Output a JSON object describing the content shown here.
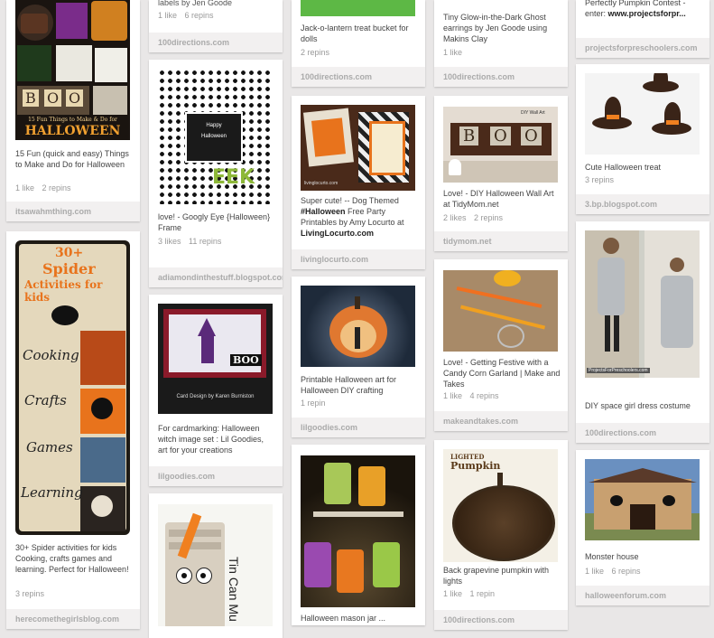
{
  "col1": {
    "pin1": {
      "desc": "15 Fun (quick and easy) Things to Make and Do for Halloween",
      "likes": "1 like",
      "repins": "2 repins",
      "source": "itsawahmthing.com",
      "img_caption": "15 Fun Things to Make & Do for",
      "img_title": "HALLOWEEN",
      "img_letters": [
        "B",
        "O",
        "O"
      ]
    },
    "pin2": {
      "desc": "30+ Spider activities for kids Cooking, crafts games and learning. Perfect for Halloween!",
      "likes": "",
      "repins": "3 repins",
      "source": "herecomethegirlsblog.com",
      "img_top": "30+",
      "img_title1": "Spider",
      "img_title2": "Activities for kids",
      "img_words": [
        "Cooking",
        "Crafts",
        "Games",
        "Learning"
      ]
    }
  },
  "col2": {
    "pin0": {
      "desc": "labels by Jen Goode",
      "likes": "1 like",
      "repins": "6 repins",
      "source": "100directions.com"
    },
    "pin1": {
      "desc": "love! - Googly Eye {Halloween} Frame",
      "likes": "3 likes",
      "repins": "11 repins",
      "source": "adiamondinthestuff.blogspot.com",
      "img_text1": "Happy",
      "img_text2": "Halloween",
      "img_text3": "EEK"
    },
    "pin2": {
      "desc": "For cardmarking: Halloween witch image set : Lil Goodies, art for your creations",
      "likes": "",
      "repins": "",
      "source": "lilgoodies.com",
      "img_boo": "BOO",
      "img_credit": "Card Design by Karen Burniston"
    },
    "pin3": {
      "desc": "",
      "likes": "",
      "repins": "",
      "source": "",
      "img_text": "Tin Can Mu"
    }
  },
  "col3": {
    "pin0": {
      "desc": "Jack-o-lantern treat bucket for dolls",
      "likes": "",
      "repins": "2 repins",
      "source": "100directions.com"
    },
    "pin1": {
      "desc_pre": "Super cute! -- Dog Themed ",
      "desc_bold": "#Halloween",
      "desc_post": " Free Party Printables by Amy Locurto at ",
      "desc_bold2": "LivingLocurto.com",
      "likes": "",
      "repins": "",
      "source": "livinglocurto.com",
      "img_credit": "livinglocurto.com"
    },
    "pin2": {
      "desc": "Printable Halloween art for Halloween DIY crafting",
      "likes": "",
      "repins": "1 repin",
      "source": "lilgoodies.com"
    },
    "pin3": {
      "desc": "Halloween mason jar ...",
      "likes": "",
      "repins": "",
      "source": ""
    }
  },
  "col4": {
    "pin0": {
      "desc": "Tiny Glow-in-the-Dark Ghost earrings by Jen Goode using Makins Clay",
      "likes": "1 like",
      "repins": "",
      "source": "100directions.com"
    },
    "pin1": {
      "desc": "Love! - DIY Halloween Wall Art at TidyMom.net",
      "likes": "2 likes",
      "repins": "2 repins",
      "source": "tidymom.net",
      "img_letters": [
        "B",
        "O",
        "O"
      ],
      "img_brand": "DIY Wall Art"
    },
    "pin2": {
      "desc": "Love! - Getting Festive with a Candy Corn Garland | Make and Takes",
      "likes": "1 like",
      "repins": "4 repins",
      "source": "makeandtakes.com"
    },
    "pin3": {
      "desc": "Back grapevine pumpkin with lights",
      "likes": "1 like",
      "repins": "1 repin",
      "source": "100directions.com",
      "img_title1": "LIGHTED",
      "img_title2": "Pumpkin"
    }
  },
  "col5": {
    "pin0": {
      "desc_pre": "Perfectly Pumpkin Contest - enter: ",
      "desc_bold": "www.projectsforpr...",
      "likes": "",
      "repins": "",
      "source": "projectsforpreschoolers.com"
    },
    "pin1": {
      "desc": "Cute Halloween treat",
      "likes": "",
      "repins": "3 repins",
      "source": "3.bp.blogspot.com"
    },
    "pin2": {
      "desc": "DIY space girl dress costume",
      "likes": "",
      "repins": "",
      "source": "100directions.com",
      "img_credit": "ProjectsForPreschoolers.com"
    },
    "pin3": {
      "desc": "Monster house",
      "likes": "1 like",
      "repins": "6 repins",
      "source": "halloweenforum.com"
    }
  },
  "colors": {
    "background": "#e9e7e7",
    "card": "#ffffff",
    "footer": "#f2f0f0",
    "orange": "#e8731c"
  }
}
